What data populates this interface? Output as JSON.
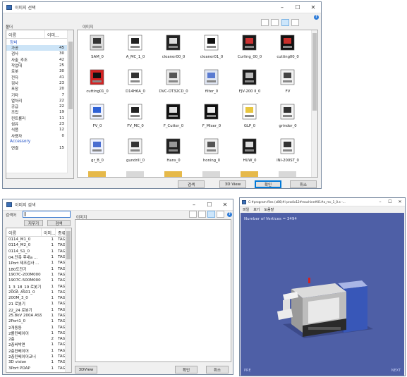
{
  "win1": {
    "title": "이미지 선택",
    "folder_label": "폴더",
    "image_label": "이미지",
    "col_name": "이름",
    "col_count": "이미...",
    "groups": [
      {
        "name": "장비",
        "items": [
          {
            "name": "가공",
            "count": "45"
          },
          {
            "name": "검사",
            "count": "30"
          },
          {
            "name": "사출_추조",
            "count": "42"
          },
          {
            "name": "작업대",
            "count": "25"
          },
          {
            "name": "로봇",
            "count": "30"
          },
          {
            "name": "전자",
            "count": "41"
          },
          {
            "name": "검사",
            "count": "23"
          },
          {
            "name": "포장",
            "count": "20"
          },
          {
            "name": "기타",
            "count": "7"
          },
          {
            "name": "열처리",
            "count": "22"
          },
          {
            "name": "공급",
            "count": "22"
          },
          {
            "name": "조립",
            "count": "19"
          },
          {
            "name": "컨트롤러",
            "count": "11"
          },
          {
            "name": "섬유",
            "count": "23"
          },
          {
            "name": "식품",
            "count": "12"
          },
          {
            "name": "사용자",
            "count": "0"
          }
        ]
      },
      {
        "name": "Accessory",
        "items": [
          {
            "name": "연결",
            "count": "15"
          }
        ]
      }
    ],
    "thumbs": [
      "SAM_0",
      "A_MC_1_0",
      "cleaner00_0",
      "cleaner01_0",
      "Curling_00_0",
      "cutting00_0",
      "cutting01_0",
      "D14H6A_0",
      "DVC-OT32CD_0",
      "filter_0",
      "FJV-200 II_0",
      "FV",
      "FV_0",
      "FV_MC_0",
      "F_Cutter_0",
      "F_Mixer_0",
      "GLP_0",
      "grinder_0",
      "gr_B_0",
      "gundrill_0",
      "Hans_0",
      "honing_0",
      "HUW_0",
      "INI-200ST_0"
    ],
    "buttons": {
      "search": "검색",
      "view3d": "3D View",
      "ok": "확인",
      "cancel": "취소"
    }
  },
  "win2": {
    "title": "이미지 검색",
    "search_label": "검색어",
    "image_label": "이미지",
    "btn_clear": "지우기",
    "btn_search": "검색",
    "col_name": "이름",
    "col_count": "이미...",
    "col_type": "종류",
    "rows": [
      {
        "name": "0114_M1_0",
        "count": "1",
        "type": "TAG"
      },
      {
        "name": "0114_M2_0",
        "count": "1",
        "type": "TAG"
      },
      {
        "name": "0114_S1_0",
        "count": "1",
        "type": "TAG"
      },
      {
        "name": "04.단축 후내a ...",
        "count": "1",
        "type": "TAG"
      },
      {
        "name": "1Port 제조검사 ...",
        "count": "1",
        "type": "TAG"
      },
      {
        "name": "180도전기",
        "count": "1",
        "type": "TAG"
      },
      {
        "name": "1907C-200M000",
        "count": "1",
        "type": "TAG"
      },
      {
        "name": "1907C-500M000",
        "count": "1",
        "type": "TAG"
      },
      {
        "name": "1_3_18_19 로봇기",
        "count": "1",
        "type": "TAG"
      },
      {
        "name": "200A_AS01_0",
        "count": "1",
        "type": "TAG"
      },
      {
        "name": "200M_3_0",
        "count": "1",
        "type": "TAG"
      },
      {
        "name": "21 로봇기",
        "count": "1",
        "type": "TAG"
      },
      {
        "name": "22_24 로봇기",
        "count": "1",
        "type": "TAG"
      },
      {
        "name": "25.8kV 200A ASS",
        "count": "1",
        "type": "TAG"
      },
      {
        "name": "2Port1_0",
        "count": "1",
        "type": "TAG"
      },
      {
        "name": "2개동동",
        "count": "1",
        "type": "TAG"
      },
      {
        "name": "2롤컨베이어",
        "count": "1",
        "type": "TAG"
      },
      {
        "name": "2층",
        "count": "2",
        "type": "TAG"
      },
      {
        "name": "2층버박면",
        "count": "1",
        "type": "TAG"
      },
      {
        "name": "2층컨베이어",
        "count": "1",
        "type": "TAG"
      },
      {
        "name": "2층컨베이어코너",
        "count": "1",
        "type": "TAG"
      },
      {
        "name": "3D vision",
        "count": "1",
        "type": "TAG"
      },
      {
        "name": "3Port PDAP",
        "count": "1",
        "type": "TAG"
      }
    ],
    "buttons": {
      "view3d": "3DView",
      "ok": "확인",
      "cancel": "취소"
    }
  },
  "win3": {
    "title": "C:#program files (x86)#i-prodix12#machine#01#a_mc_1_0.x -...",
    "menu": [
      "파일",
      "보기",
      "도움말"
    ],
    "vertices": "Number of Vertices = 3494",
    "prev": "PRE",
    "next": "NEXT"
  }
}
